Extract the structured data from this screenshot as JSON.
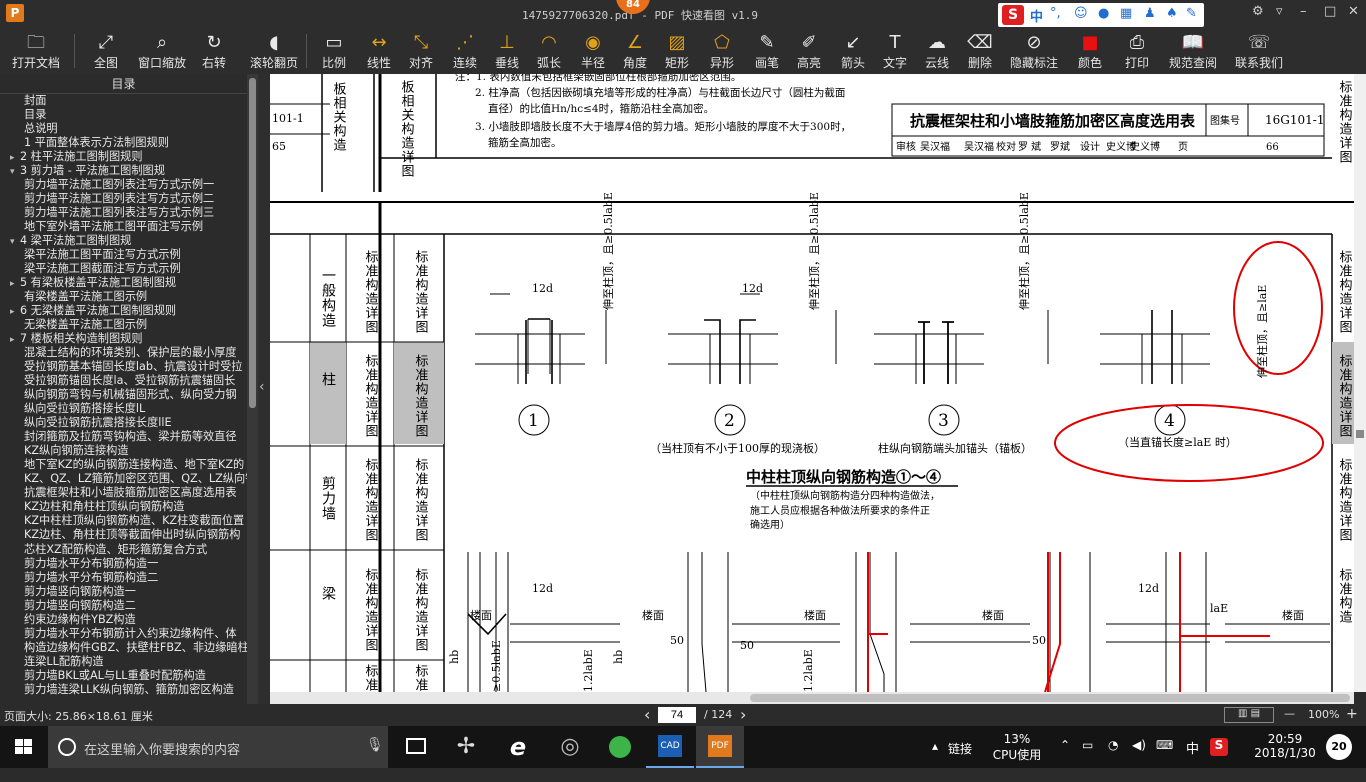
{
  "window": {
    "logo": "P",
    "title": "1475927706320.pdf - PDF 快速看图 v1.9",
    "cpu_badge": "84",
    "ime_mode": "中"
  },
  "toolbar": [
    {
      "label": "打开文档",
      "icon": "folder-icon"
    },
    {
      "label": "全图",
      "icon": "fit-page-icon"
    },
    {
      "label": "窗口缩放",
      "icon": "zoom-icon"
    },
    {
      "label": "右转",
      "icon": "rotate-right-icon"
    },
    {
      "label": "滚轮翻页",
      "icon": "mouse-wheel-icon"
    },
    {
      "label": "比例",
      "icon": "scale-ruler-icon"
    },
    {
      "label": "线性",
      "icon": "linear-dimension-icon"
    },
    {
      "label": "对齐",
      "icon": "aligned-dimension-icon"
    },
    {
      "label": "连续",
      "icon": "continuous-dimension-icon"
    },
    {
      "label": "垂线",
      "icon": "perpendicular-icon"
    },
    {
      "label": "弧长",
      "icon": "arc-length-icon"
    },
    {
      "label": "半径",
      "icon": "radius-icon"
    },
    {
      "label": "角度",
      "icon": "angle-icon"
    },
    {
      "label": "矩形",
      "icon": "rectangle-area-icon"
    },
    {
      "label": "异形",
      "icon": "polygon-area-icon"
    },
    {
      "label": "画笔",
      "icon": "pen-icon"
    },
    {
      "label": "高亮",
      "icon": "highlighter-icon"
    },
    {
      "label": "箭头",
      "icon": "arrow-icon"
    },
    {
      "label": "文字",
      "icon": "text-icon"
    },
    {
      "label": "云线",
      "icon": "cloud-line-icon"
    },
    {
      "label": "删除",
      "icon": "eraser-icon"
    },
    {
      "label": "隐藏标注",
      "icon": "hide-markup-icon"
    },
    {
      "label": "颜色",
      "icon": "color-swatch-icon",
      "value": "#e81010"
    },
    {
      "label": "打印",
      "icon": "printer-icon"
    },
    {
      "label": "规范查阅",
      "icon": "book-icon"
    },
    {
      "label": "联系我们",
      "icon": "contact-icon"
    }
  ],
  "sidebar": {
    "title": "目录",
    "items": [
      {
        "t": "封面",
        "lvl": 1,
        "tg": ""
      },
      {
        "t": "目录",
        "lvl": 1,
        "tg": ""
      },
      {
        "t": "总说明",
        "lvl": 1,
        "tg": ""
      },
      {
        "t": "1 平面整体表示方法制图规则",
        "lvl": 1,
        "tg": ""
      },
      {
        "t": "2 柱平法施工图制图规则",
        "lvl": 0,
        "tg": "▸"
      },
      {
        "t": "3 剪力墙 - 平法施工图制图规",
        "lvl": 0,
        "tg": "▾"
      },
      {
        "t": "剪力墙平法施工图列表注写方式示例一",
        "lvl": 2,
        "tg": ""
      },
      {
        "t": "剪力墙平法施工图列表注写方式示例二",
        "lvl": 2,
        "tg": ""
      },
      {
        "t": "剪力墙平法施工图列表注写方式示例三",
        "lvl": 2,
        "tg": ""
      },
      {
        "t": "地下室外墙平法施工图平面注写示例",
        "lvl": 2,
        "tg": ""
      },
      {
        "t": "4 梁平法施工图制图规",
        "lvl": 0,
        "tg": "▾"
      },
      {
        "t": "梁平法施工图平面注写方式示例",
        "lvl": 2,
        "tg": ""
      },
      {
        "t": "梁平法施工图截面注写方式示例",
        "lvl": 2,
        "tg": ""
      },
      {
        "t": "5 有梁板楼盖平法施工图制图规",
        "lvl": 0,
        "tg": "▸"
      },
      {
        "t": "有梁楼盖平法施工图示例",
        "lvl": 2,
        "tg": ""
      },
      {
        "t": "6 无梁楼盖平法施工图制图规则",
        "lvl": 0,
        "tg": "▸"
      },
      {
        "t": "无梁楼盖平法施工图示例",
        "lvl": 2,
        "tg": ""
      },
      {
        "t": "7 楼板相关构造制图规则",
        "lvl": 0,
        "tg": "▸"
      },
      {
        "t": "混凝土结构的环境类别、保护层的最小厚度",
        "lvl": 2,
        "tg": ""
      },
      {
        "t": "受拉钢筋基本锚固长度lab、抗震设计时受拉",
        "lvl": 2,
        "tg": ""
      },
      {
        "t": "受拉钢筋锚固长度la、受拉钢筋抗震锚固长",
        "lvl": 2,
        "tg": ""
      },
      {
        "t": "纵向钢筋弯钩与机械锚固形式、纵向受力钢",
        "lvl": 2,
        "tg": ""
      },
      {
        "t": "纵向受拉钢筋搭接长度lL",
        "lvl": 2,
        "tg": ""
      },
      {
        "t": "纵向受拉钢筋抗震搭接长度llE",
        "lvl": 2,
        "tg": ""
      },
      {
        "t": "封闭箍筋及拉筋弯钩构造、梁并筋等效直径",
        "lvl": 2,
        "tg": ""
      },
      {
        "t": "KZ纵向钢筋连接构造",
        "lvl": 2,
        "tg": ""
      },
      {
        "t": "地下室KZ的纵向钢筋连接构造、地下室KZ的",
        "lvl": 2,
        "tg": ""
      },
      {
        "t": "KZ、QZ、LZ箍筋加密区范围、QZ、LZ纵向钢",
        "lvl": 2,
        "tg": ""
      },
      {
        "t": "抗震框架柱和小墙肢箍筋加密区高度选用表",
        "lvl": 2,
        "tg": ""
      },
      {
        "t": "KZ边柱和角柱柱顶纵向钢筋构造",
        "lvl": 2,
        "tg": ""
      },
      {
        "t": "KZ中柱柱顶纵向钢筋构造、KZ柱变截面位置",
        "lvl": 2,
        "tg": ""
      },
      {
        "t": "KZ边柱、角柱柱顶等截面伸出时纵向钢筋构",
        "lvl": 2,
        "tg": ""
      },
      {
        "t": "芯柱XZ配筋构造、矩形箍筋复合方式",
        "lvl": 2,
        "tg": ""
      },
      {
        "t": "剪力墙水平分布钢筋构造一",
        "lvl": 2,
        "tg": ""
      },
      {
        "t": "剪力墙水平分布钢筋构造二",
        "lvl": 2,
        "tg": ""
      },
      {
        "t": "剪力墙竖向钢筋构造一",
        "lvl": 2,
        "tg": ""
      },
      {
        "t": "剪力墙竖向钢筋构造二",
        "lvl": 2,
        "tg": ""
      },
      {
        "t": "约束边缘构件YBZ构造",
        "lvl": 2,
        "tg": ""
      },
      {
        "t": "剪力墙水平分布钢筋计入约束边缘构件、体",
        "lvl": 2,
        "tg": ""
      },
      {
        "t": "构造边缘构件GBZ、扶壁柱FBZ、非边缘暗柱",
        "lvl": 2,
        "tg": ""
      },
      {
        "t": "连梁LL配筋构造",
        "lvl": 2,
        "tg": ""
      },
      {
        "t": "剪力墙BKL或AL与LL重叠时配筋构造",
        "lvl": 2,
        "tg": ""
      },
      {
        "t": "剪力墙连梁LLK纵向钢筋、箍筋加密区构造",
        "lvl": 2,
        "tg": ""
      }
    ]
  },
  "document": {
    "top_notes": [
      "注：1. 表内数值未包括框架嵌固部位柱根部箍筋加密区范围。",
      "2. 柱净高（包括因嵌砌填充墙等形成的柱净高）与柱截面长边尺寸（圆柱为截面",
      "直径）的比值Hn/hc≤4时，箍筋沿柱全高加密。",
      "3. 小墙肢即墙肢长度不大于墙厚4倍的剪力墙。矩形小墙肢的厚度不大于300时，",
      "箍筋全高加密。"
    ],
    "title_block": {
      "title": "抗震框架柱和小墙肢箍筋加密区高度选用表",
      "atlas_label": "图集号",
      "atlas_no": "16G101-1",
      "review_row": [
        "审核",
        "吴汉福",
        "吴汉福",
        "校对",
        "罗 斌",
        "罗斌",
        "设计",
        "史义博",
        "史义博",
        "页",
        "66"
      ]
    },
    "left_strip_top": {
      "code": "101-1",
      "page": "65"
    },
    "left_cat_col": [
      "板相关构造",
      "板相关构造详图"
    ],
    "categories": [
      {
        "a": "一般构造",
        "b": "标准构造详图"
      },
      {
        "a": "柱",
        "b": "标准构造详图"
      },
      {
        "a": "剪力墙",
        "b": "标准构造详图"
      },
      {
        "a": "梁",
        "b": "标准构造详图"
      },
      {
        "a": "",
        "b": "标准"
      }
    ],
    "right_tabs": [
      "标准构造详图",
      "标准构造详图",
      "标准构造详图",
      "标准构造详图",
      "标准构造"
    ],
    "detail_labels": {
      "d12": "12d",
      "d12_left": "12d",
      "anchor": "伸至柱顶，且≥0.5labE",
      "anchor_circle": "伸至柱顶，且≥laE",
      "n1": "1",
      "n2": "2",
      "n3": "3",
      "n4": "4",
      "cap2": "（当柱顶有不小于100厚的现浇板）",
      "cap3": "柱纵向钢筋端头加锚头（锚板）",
      "cap4": "（当直锚长度≥laE 时）",
      "section_title": "中柱柱顶纵向钢筋构造①～④",
      "section_note1": "（中柱柱顶纵向钢筋构造分四种构造做法，",
      "section_note2": "施工人员应根据各种做法所要求的条件正",
      "section_note3": "确选用）",
      "floor": "楼面",
      "d50": "50",
      "hb": "hb",
      "half_lab": "≥0.5labE",
      "lab12": "1.2labE",
      "lae": "laE"
    },
    "markup_color": "#e00000"
  },
  "statusbar": {
    "page_size": "页面大小: 25.86×18.61 厘米",
    "current_page": "74",
    "total_pages": "/ 124",
    "zoom": "100%",
    "prev": "‹",
    "next": "›",
    "zoom_out": "—",
    "zoom_in": "+"
  },
  "taskbar": {
    "search_placeholder": "在这里输入你要搜索的内容",
    "tray_link": "链接",
    "cpu_pct": "13%",
    "cpu_label": "CPU使用",
    "lang": "中",
    "time": "20:59",
    "date": "2018/1/30",
    "notifications": "20"
  }
}
